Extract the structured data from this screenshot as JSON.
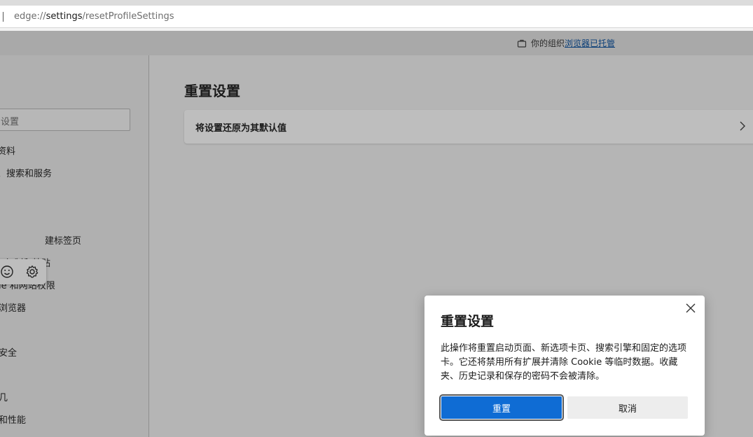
{
  "browser": {
    "url_prefix": "edge://",
    "url_host": "settings",
    "url_path": "/resetProfileSettings"
  },
  "managed_notice": {
    "prefix": "你的组织",
    "link": "浏览器已托管"
  },
  "sidebar": {
    "search_placeholder": "设置",
    "items": [
      {
        "label": "资料"
      },
      {
        "label": "、搜索和服务"
      },
      {
        "label": "建标签页"
      },
      {
        "label": "复制和粘贴"
      },
      {
        "label": "ie 和网站权限"
      },
      {
        "label": "浏览器"
      },
      {
        "label": "安全"
      },
      {
        "label": "几"
      },
      {
        "label": "和性能"
      }
    ]
  },
  "main": {
    "title": "重置设置",
    "card_label": "将设置还原为其默认值"
  },
  "dialog": {
    "title": "重置设置",
    "message": "此操作将重置启动页面、新选项卡页、搜索引擎和固定的选项卡。它还将禁用所有扩展并清除 Cookie 等临时数据。收藏夹、历史记录和保存的密码不会被清除。",
    "reset_label": "重置",
    "cancel_label": "取消"
  },
  "colors": {
    "accent": "#0f6cd4",
    "link": "#0b3f78"
  }
}
